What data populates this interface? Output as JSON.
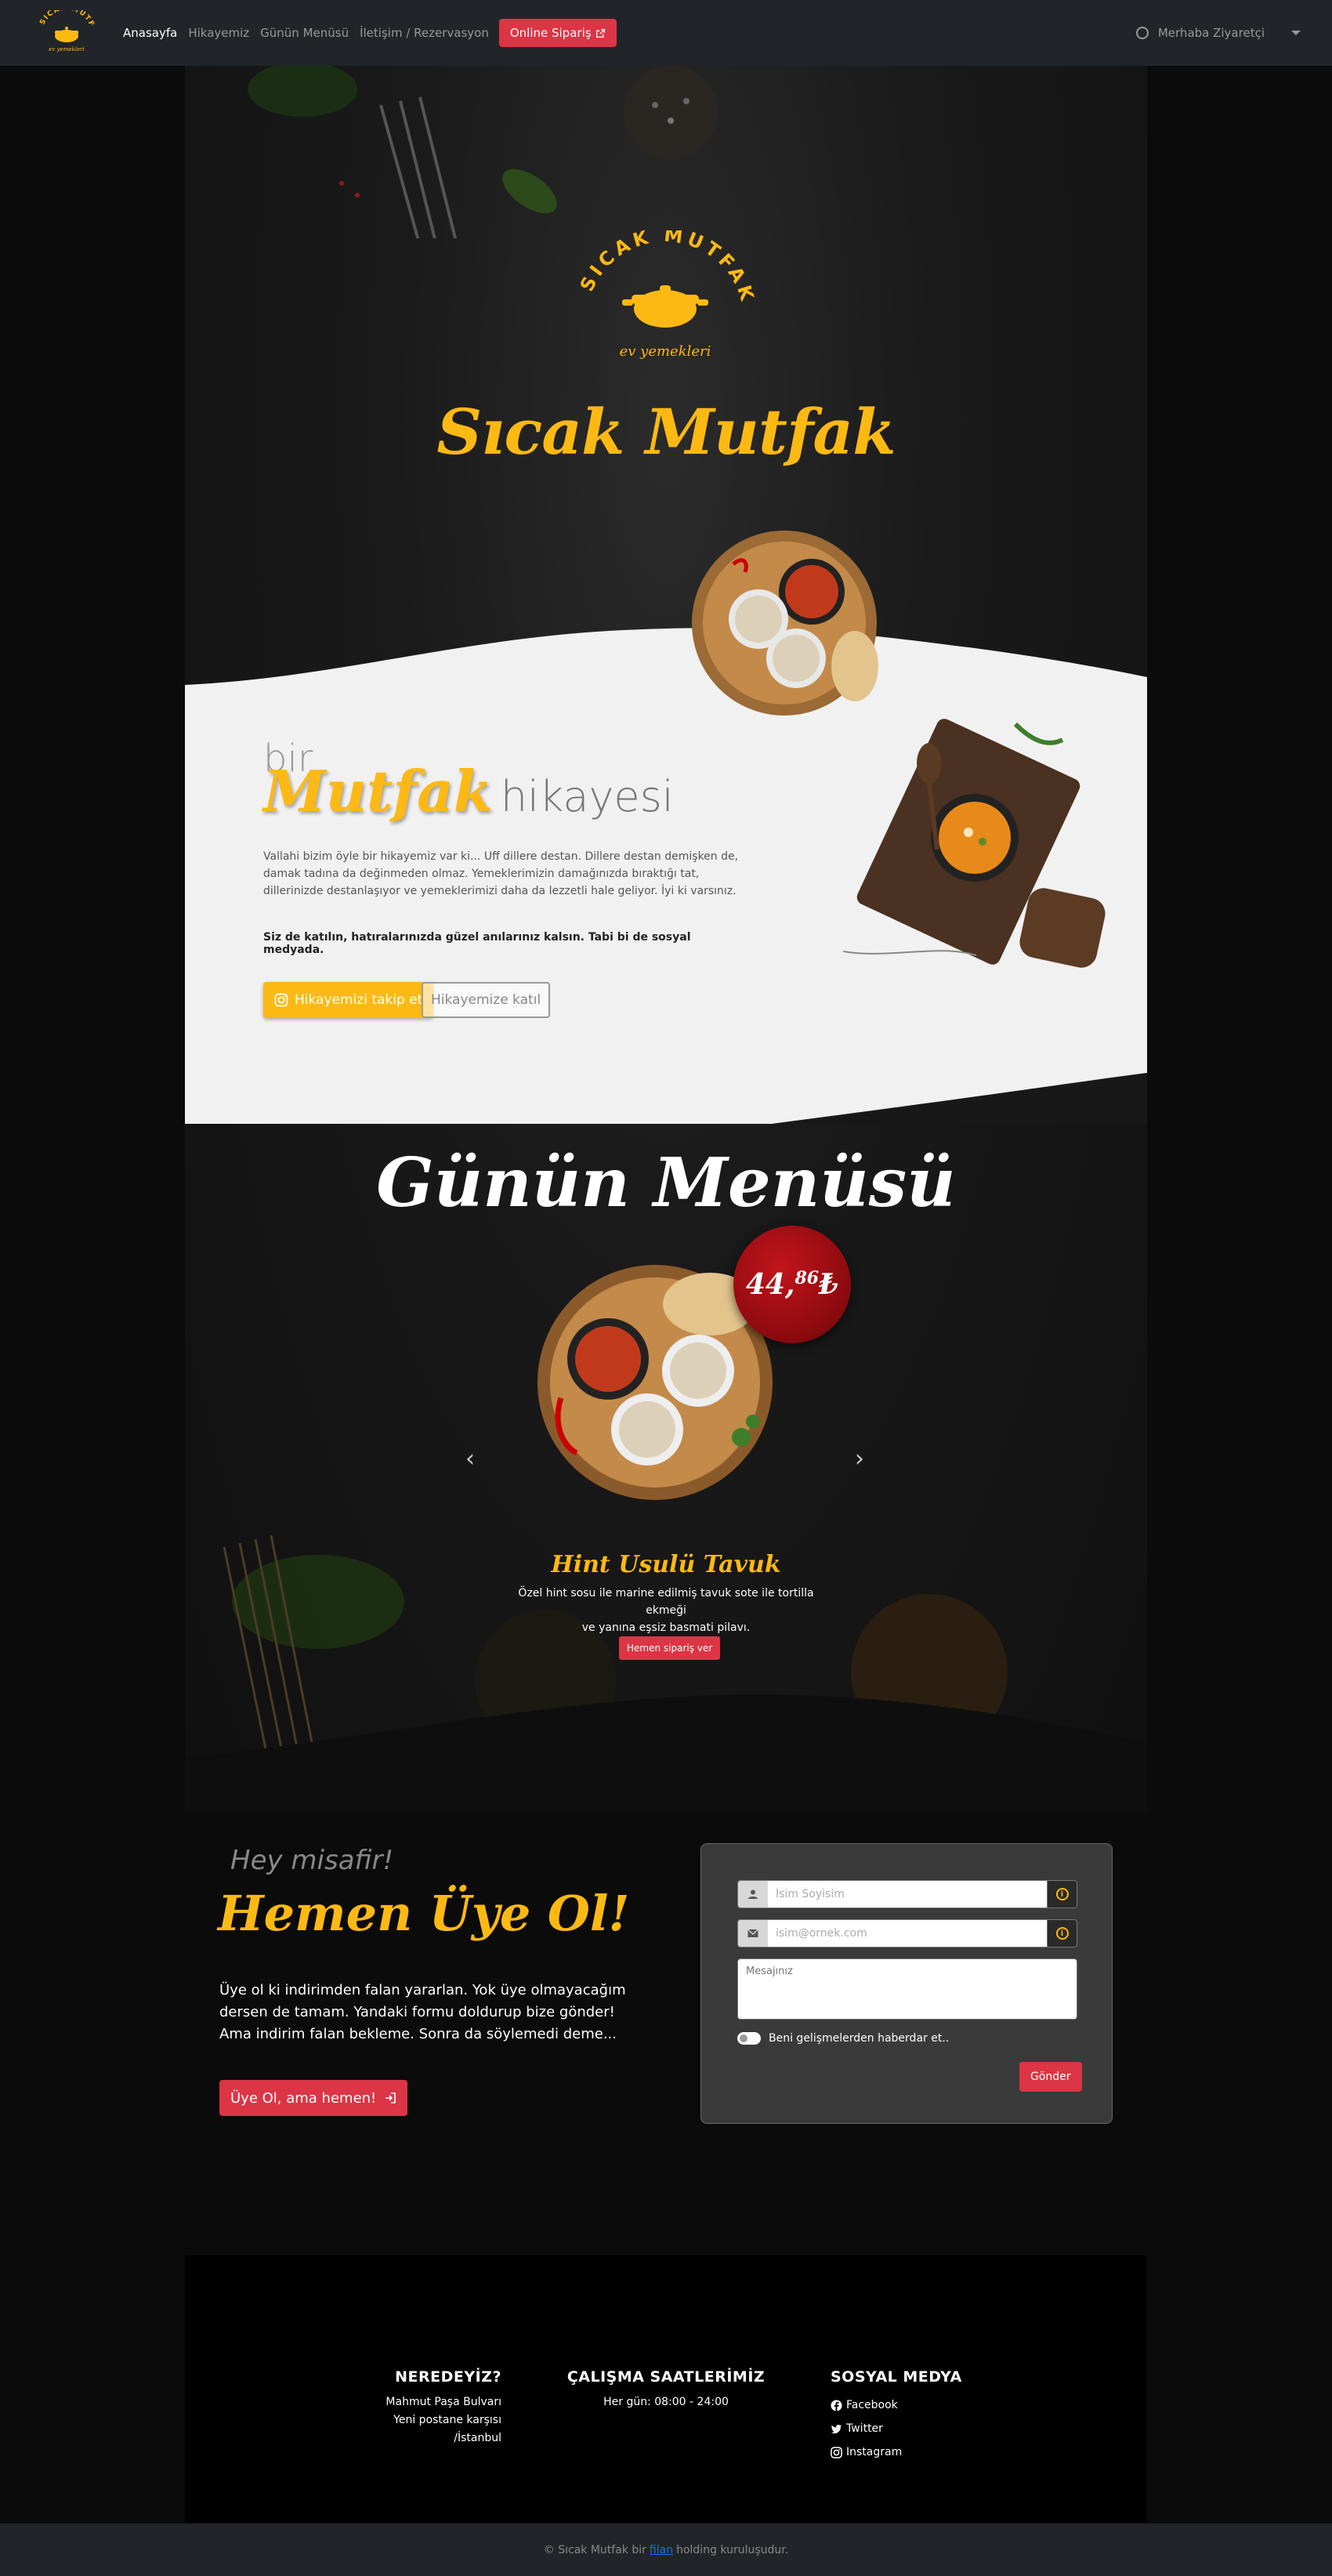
{
  "nav": {
    "logo_text": "SICAK MUTFAK",
    "links": [
      "Anasayfa",
      "Hikayemiz",
      "Günün Menüsü",
      "İletişim / Rezervasyon"
    ],
    "order_button": "Online Sipariş",
    "user_greeting": "Merhaba Ziyaretçi"
  },
  "hero": {
    "logo_text": "SICAK MUTFAK",
    "logo_subtext": "ev yemekleri",
    "title": "Sıcak Mutfak"
  },
  "story": {
    "heading_bir": "bir",
    "heading_mutfak": "Mutfak",
    "heading_hikayesi": "hikayesi",
    "paragraph": "Vallahi bizim öyle bir hikayemiz var ki... Uff dillere destan. Dillere destan demişken de, damak tadına da değinmeden olmaz. Yemeklerimizin damağınızda bıraktığı tat, dillerinizde destanlaşıyor ve yemeklerimizi daha da lezzetli hale geliyor. İyi ki varsınız.",
    "bold_line": "Siz de katılın, hatıralarınızda güzel anılarınız kalsın. Tabi bi de sosyal medyada.",
    "instagram_button": "Hikayemizi takip et",
    "join_button": "Hikayemize katıl"
  },
  "menu": {
    "title": "Günün Menüsü",
    "price_main": "44,",
    "price_cents": "86",
    "price_currency": "₺",
    "dish_name": "Hint Usulü Tavuk",
    "dish_desc_line1": "Özel hint sosu ile marine edilmiş tavuk sote ile tortilla ekmeği",
    "dish_desc_line2": "ve yanına eşsiz basmati pilavı.",
    "order_button": "Hemen sipariş ver"
  },
  "signup": {
    "hey": "Hey misafir!",
    "title": "Hemen Üye Ol!",
    "text": "Üye ol ki indirimden falan yararlan. Yok üye olmayacağım dersen de tamam. Yandaki formu doldurup bize gönder! Ama indirim falan bekleme. Sonra da söylemedi deme...",
    "join_button": "Üye Ol, ama hemen!"
  },
  "form": {
    "name_placeholder": "İsim Soyisim",
    "email_placeholder": "isim@ornek.com",
    "message_placeholder": "Mesajınız",
    "toggle_label": "Beni gelişmelerden haberdar et..",
    "send_button": "Gönder"
  },
  "footer": {
    "where_title": "NEREDEYİZ?",
    "where_line1": "Mahmut Paşa Bulvarı",
    "where_line2": "Yeni postane karşısı",
    "where_line3": "/İstanbul",
    "hours_title": "ÇALIŞMA SAATLERİMİZ",
    "hours_text": "Her gün: 08:00 - 24:00",
    "social_title": "SOSYAL MEDYA",
    "social_items": [
      "Facebook",
      "Twitter",
      "Instagram"
    ],
    "copyright_pre": "© Sıcak Mutfak bir",
    "copyright_link": "filan",
    "copyright_post": "holding kuruluşudur."
  },
  "colors": {
    "accent_yellow": "#fdb913",
    "accent_red": "#dc3545",
    "navbar": "#212529"
  }
}
